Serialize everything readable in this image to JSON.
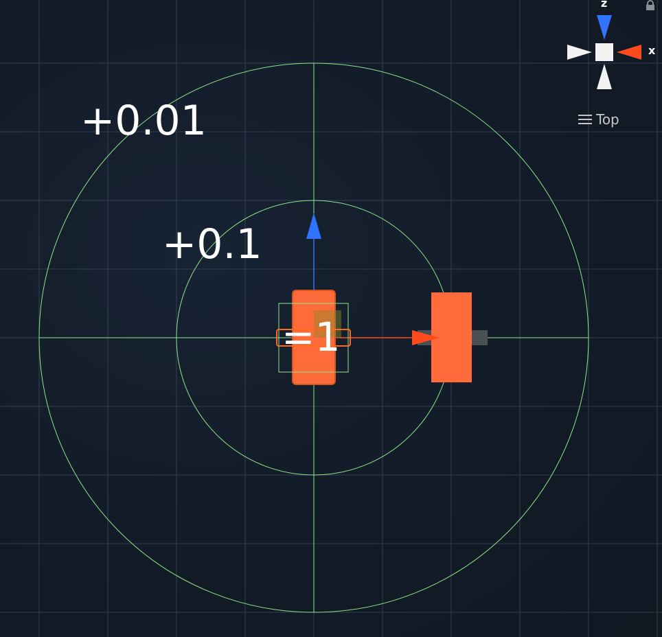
{
  "scene_view": {
    "snap_labels": {
      "outer": "+0.01",
      "middle": "+0.1",
      "center": "=1"
    },
    "orientation_gizmo": {
      "z_axis_label": "z",
      "x_axis_label": "x",
      "view_name": "Top"
    },
    "colors": {
      "background": "#121b27",
      "grid": "#3a4656",
      "rings": "#8ee88a",
      "object": "#ff6b3a",
      "x_axis": "#ff4a1e",
      "z_axis": "#2f73ff",
      "gizmo_neutral": "#f2f2f2"
    },
    "icons": [
      "menu-icon",
      "lock-icon",
      "x-arrow-icon",
      "z-arrow-icon"
    ]
  }
}
